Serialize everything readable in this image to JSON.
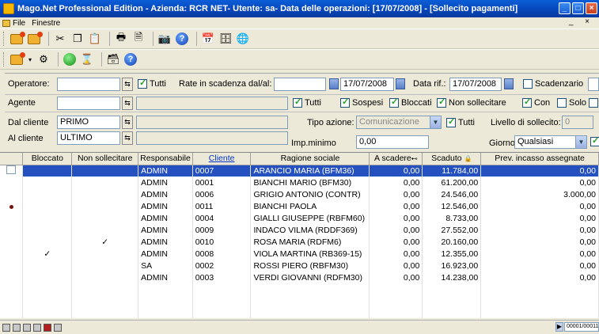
{
  "window": {
    "title": "Mago.Net Professional Edition - Azienda: RCR NET- Utente: sa- Data delle operazioni: [17/07/2008] - [Sollecito pagamenti]",
    "minimize": "_",
    "restore": "□",
    "close": "×"
  },
  "menu": {
    "file": "File",
    "finestre": "Finestre",
    "right": "_ ×"
  },
  "form": {
    "operatore_label": "Operatore:",
    "operatore_value": "",
    "tutti_label": "Tutti",
    "rate_label": "Rate in scadenza dal/al:",
    "rate_from": "",
    "rate_to": "17/07/2008",
    "data_rif_label": "Data rif.:",
    "data_rif_value": "17/07/2008",
    "scadenzario_label": "Scadenzario",
    "agente_label": "Agente",
    "agente_value": "",
    "agente_desc": "",
    "agente_tutti_label": "Tutti",
    "sospesi_label": "Sospesi",
    "bloccati_label": "Bloccati",
    "non_sollecitare_label": "Non sollecitare",
    "con_label": "Con",
    "solo_label": "Solo",
    "dal_cliente_label": "Dal cliente",
    "dal_cliente_value": "PRIMO",
    "al_cliente_label": "Al cliente",
    "al_cliente_value": "ULTIMO",
    "tipo_azione_label": "Tipo azione:",
    "tipo_azione_value": "Comunicazione",
    "tipo_tutti_label": "Tutti",
    "livello_label": "Livello di sollecito:",
    "livello_value": "0",
    "imp_minimo_label": "Imp.minimo",
    "imp_minimo_value": "0,00",
    "giorno_label": "Giorno",
    "giorno_value": "Qualsiasi"
  },
  "grid": {
    "columns": [
      "",
      "Bloccato",
      "Non sollecitare",
      "Responsabile",
      "Cliente",
      "Ragione sociale",
      "A scadere",
      "Scaduto",
      "Prev. incasso assegnate"
    ],
    "rows": [
      {
        "bloccato": "",
        "non_sollecitare": "",
        "responsabile": "ADMIN",
        "cliente": "0007",
        "ragione": "ARANCIO MARIA (BFM36)",
        "a_scadere": "0,00",
        "scaduto": "11.784,00",
        "prev": "0,00",
        "dot": false,
        "selected": true
      },
      {
        "bloccato": "",
        "non_sollecitare": "",
        "responsabile": "ADMIN",
        "cliente": "0001",
        "ragione": "BIANCHI MARIO (BFM30)",
        "a_scadere": "0,00",
        "scaduto": "61.200,00",
        "prev": "0,00",
        "dot": false,
        "selected": false
      },
      {
        "bloccato": "",
        "non_sollecitare": "",
        "responsabile": "ADMIN",
        "cliente": "0006",
        "ragione": "GRIGIO ANTONIO (CONTR)",
        "a_scadere": "0,00",
        "scaduto": "24.546,00",
        "prev": "3.000,00",
        "dot": false,
        "selected": false
      },
      {
        "bloccato": "",
        "non_sollecitare": "",
        "responsabile": "ADMIN",
        "cliente": "0011",
        "ragione": "BIANCHI PAOLA",
        "a_scadere": "0,00",
        "scaduto": "12.546,00",
        "prev": "0,00",
        "dot": true,
        "selected": false
      },
      {
        "bloccato": "",
        "non_sollecitare": "",
        "responsabile": "ADMIN",
        "cliente": "0004",
        "ragione": "GIALLI GIUSEPPE (RBFM60)",
        "a_scadere": "0,00",
        "scaduto": "8.733,00",
        "prev": "0,00",
        "dot": false,
        "selected": false
      },
      {
        "bloccato": "",
        "non_sollecitare": "",
        "responsabile": "ADMIN",
        "cliente": "0009",
        "ragione": "INDACO VILMA (RDDF369)",
        "a_scadere": "0,00",
        "scaduto": "27.552,00",
        "prev": "0,00",
        "dot": false,
        "selected": false
      },
      {
        "bloccato": "",
        "non_sollecitare": "✓",
        "responsabile": "ADMIN",
        "cliente": "0010",
        "ragione": "ROSA MARIA (RDFM6)",
        "a_scadere": "0,00",
        "scaduto": "20.160,00",
        "prev": "0,00",
        "dot": false,
        "selected": false
      },
      {
        "bloccato": "✓",
        "non_sollecitare": "",
        "responsabile": "ADMIN",
        "cliente": "0008",
        "ragione": "VIOLA MARTINA (RB369-15)",
        "a_scadere": "0,00",
        "scaduto": "12.355,00",
        "prev": "0,00",
        "dot": false,
        "selected": false
      },
      {
        "bloccato": "",
        "non_sollecitare": "",
        "responsabile": "SA",
        "cliente": "0002",
        "ragione": "ROSSI PIERO (RBFM30)",
        "a_scadere": "0,00",
        "scaduto": "16.923,00",
        "prev": "0,00",
        "dot": false,
        "selected": false
      },
      {
        "bloccato": "",
        "non_sollecitare": "",
        "responsabile": "ADMIN",
        "cliente": "0003",
        "ragione": "VERDI GIOVANNI (RDFM30)",
        "a_scadere": "0,00",
        "scaduto": "14.238,00",
        "prev": "0,00",
        "dot": false,
        "selected": false
      }
    ]
  },
  "status": {
    "pager": "00001/00011"
  }
}
